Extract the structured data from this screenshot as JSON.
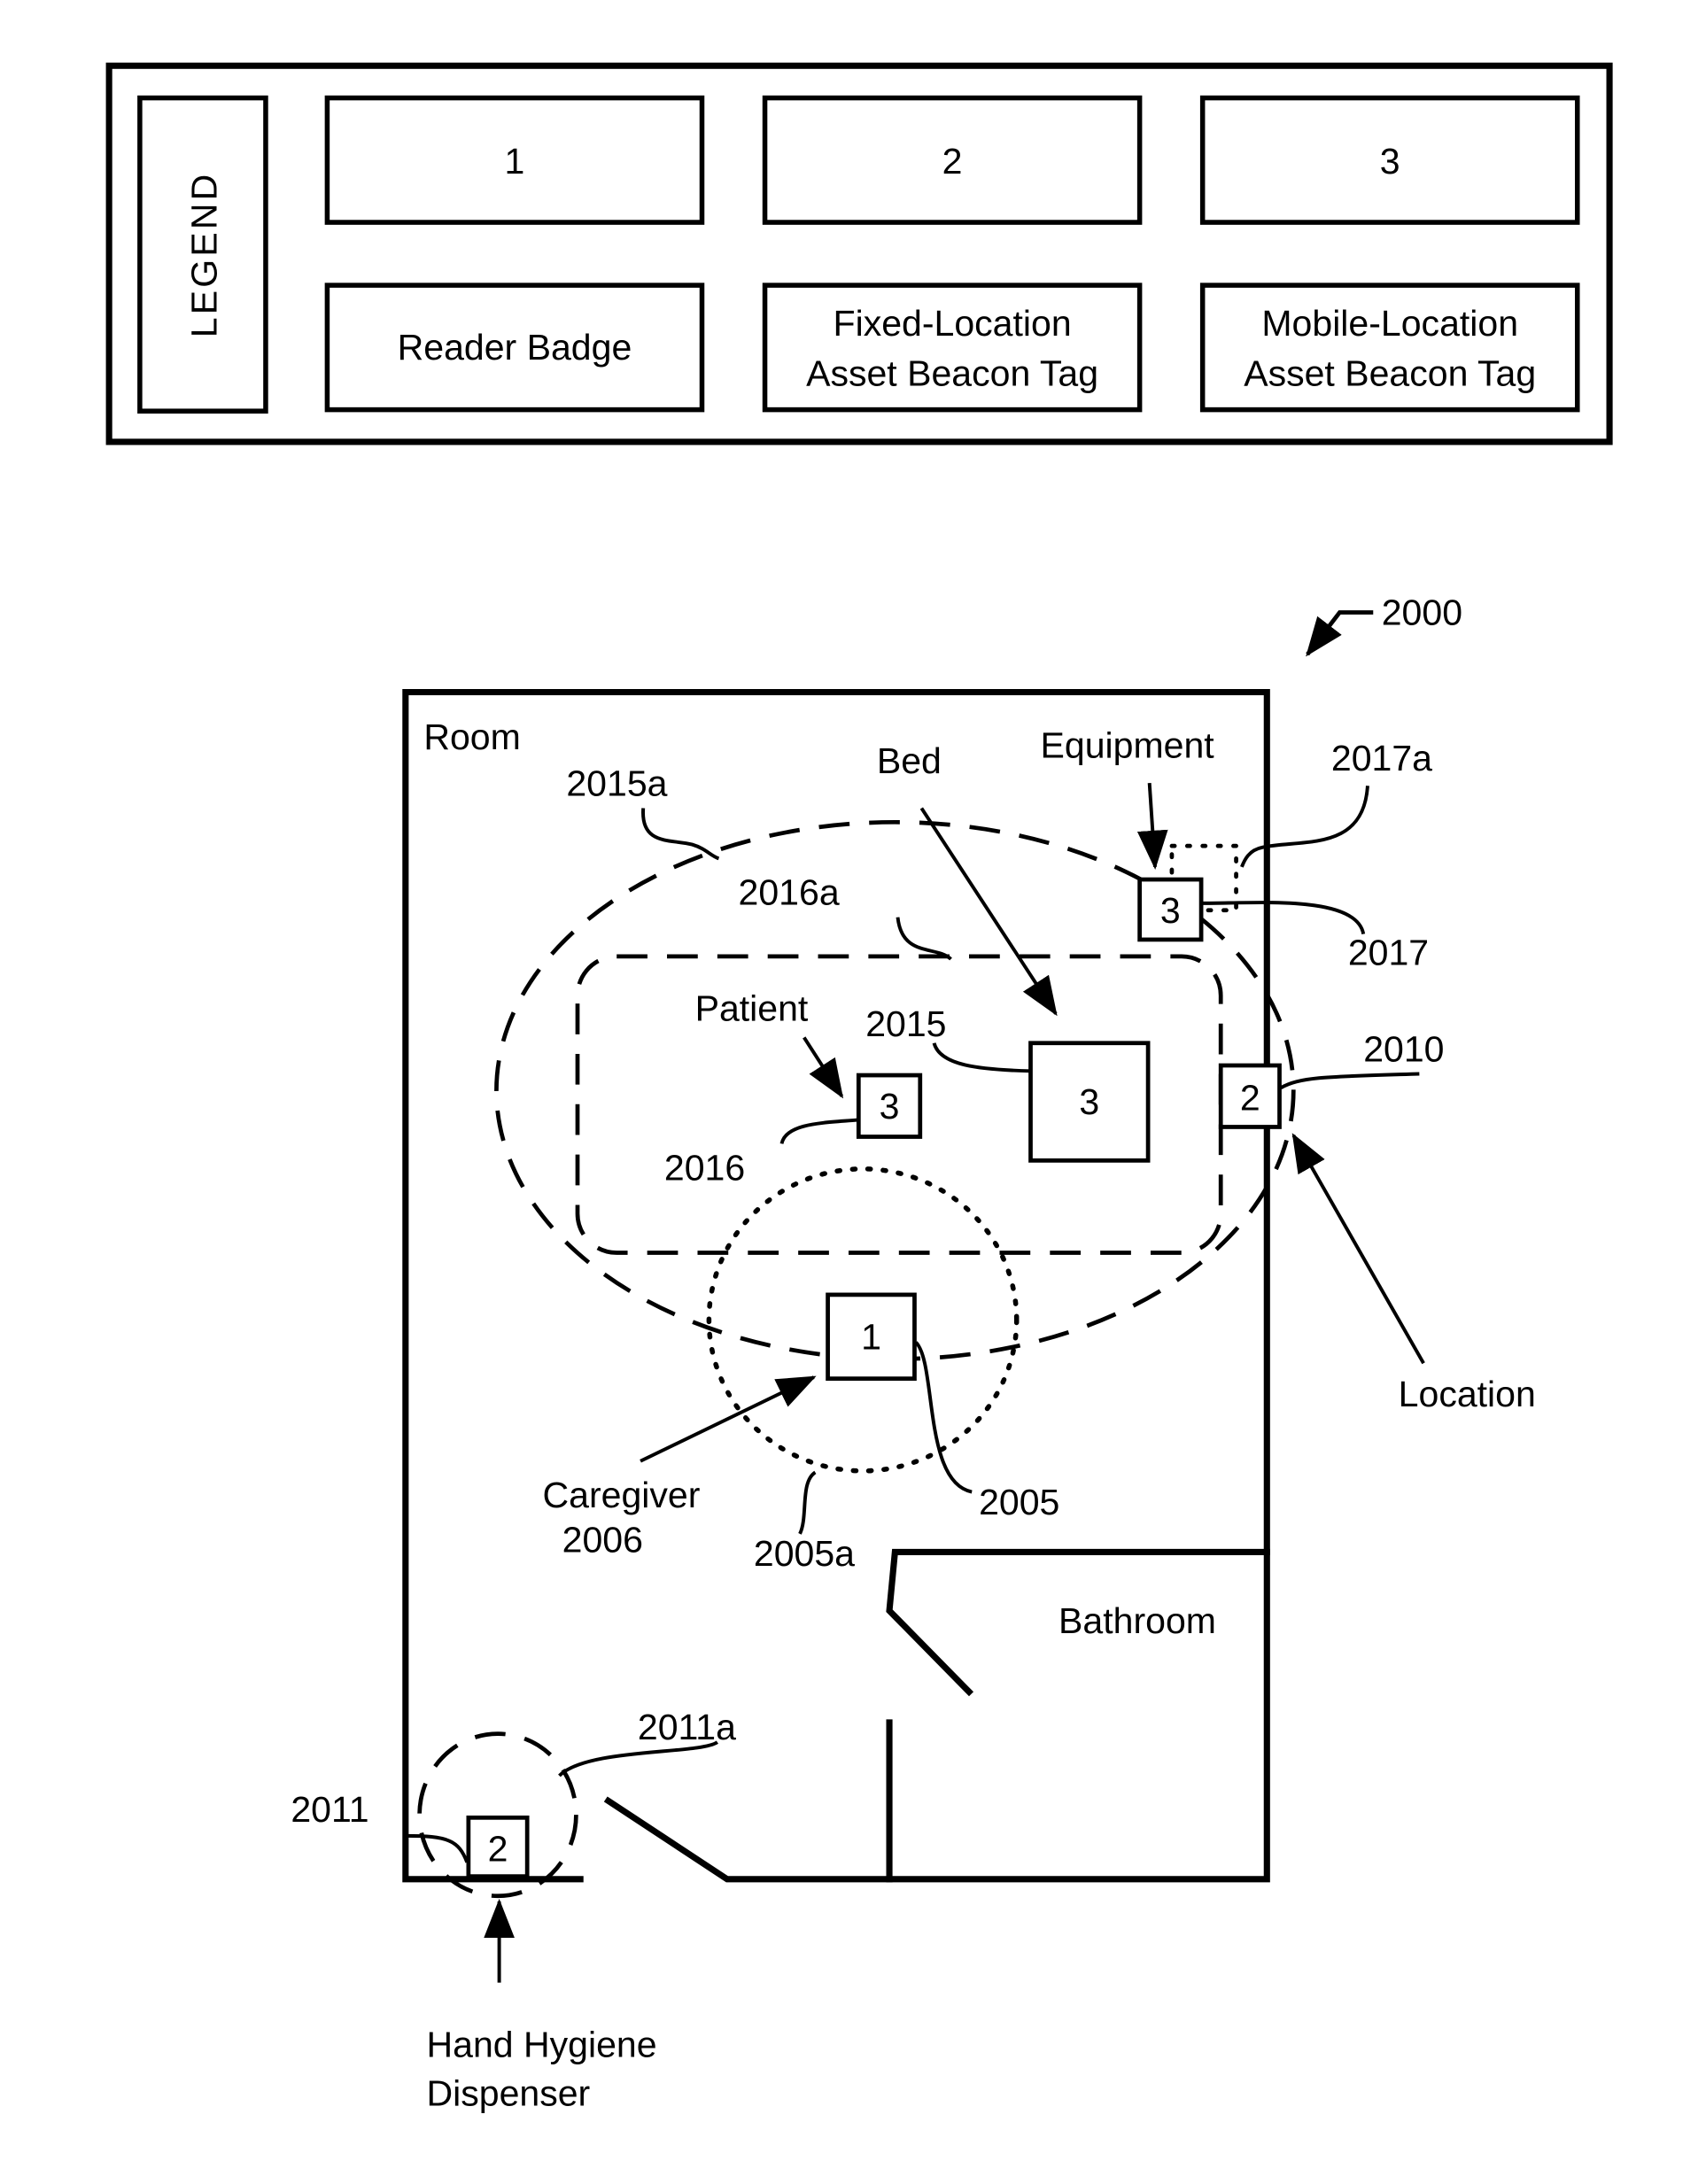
{
  "legend": {
    "title": "LEGEND",
    "items": [
      {
        "symbol": "1",
        "description": "Reader Badge"
      },
      {
        "symbol": "2",
        "description_line1": "Fixed-Location",
        "description_line2": "Asset Beacon Tag"
      },
      {
        "symbol": "3",
        "description_line1": "Mobile-Location",
        "description_line2": "Asset Beacon Tag"
      }
    ]
  },
  "figure": {
    "ref": "2000",
    "room_label": "Room",
    "bathroom_label": "Bathroom",
    "labels": {
      "bed": "Bed",
      "equipment": "Equipment",
      "patient": "Patient",
      "location": "Location",
      "caregiver": "Caregiver",
      "caregiver_ref": "2006",
      "hand_hygiene_line1": "Hand Hygiene",
      "hand_hygiene_line2": "Dispenser"
    },
    "refs": {
      "r2015a": "2015a",
      "r2016a": "2016a",
      "r2017a": "2017a",
      "r2017": "2017",
      "r2015": "2015",
      "r2016": "2016",
      "r2010": "2010",
      "r2005": "2005",
      "r2005a": "2005a",
      "r2011": "2011",
      "r2011a": "2011a"
    },
    "tags": {
      "equipment_tag": "3",
      "patient_tag": "3",
      "bed_tag": "3",
      "location_tag": "2",
      "caregiver_badge": "1",
      "dispenser_tag": "2"
    }
  }
}
